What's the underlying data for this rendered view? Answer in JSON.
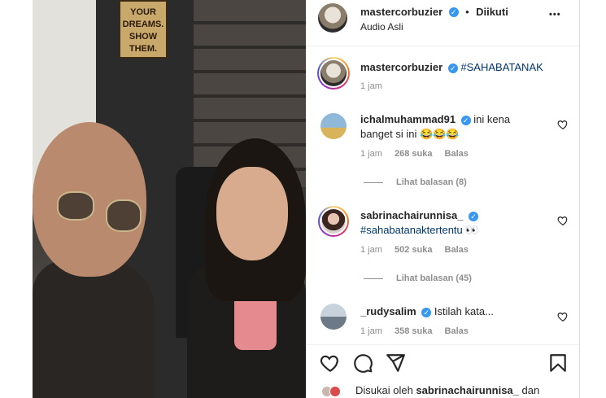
{
  "video": {
    "sign_lines": [
      "YOUR",
      "DREAMS.",
      "SHOW",
      "THEM."
    ]
  },
  "header": {
    "username": "mastercorbuzier",
    "separator": "•",
    "follow_status": "Diikuti",
    "audio": "Audio Asli",
    "more": "•••"
  },
  "caption": {
    "username": "mastercorbuzier",
    "text": "#SAHABATANAK",
    "time": "1 jam"
  },
  "comments": [
    {
      "username": "ichalmuhammad91",
      "text_line1": "ini kena",
      "text_line2": "banget si ini 😂😂😂",
      "time": "1 jam",
      "likes": "268 suka",
      "reply": "Balas",
      "view_replies": "Lihat balasan (8)"
    },
    {
      "username": "sabrinachairunnisa_",
      "text_line1": "#sahabatanaktertentu 👀",
      "time": "1 jam",
      "likes": "502 suka",
      "reply": "Balas",
      "view_replies": "Lihat balasan (45)"
    },
    {
      "username": "_rudysalim",
      "text_line1": "Istilah kata...",
      "time": "1 jam",
      "likes": "358 suka",
      "reply": "Balas"
    }
  ],
  "footer": {
    "liked_prefix": "Disukai oleh",
    "liked_user": "sabrinachairunnisa_",
    "liked_suffix": "dan"
  },
  "icons": {
    "like": "heart-icon",
    "comment": "comment-icon",
    "share": "send-icon",
    "save": "bookmark-icon",
    "verified": "verified-badge-icon"
  },
  "colors": {
    "verified": "#3897f0",
    "hashtag": "#00376b",
    "muted": "#8e8e8e"
  }
}
